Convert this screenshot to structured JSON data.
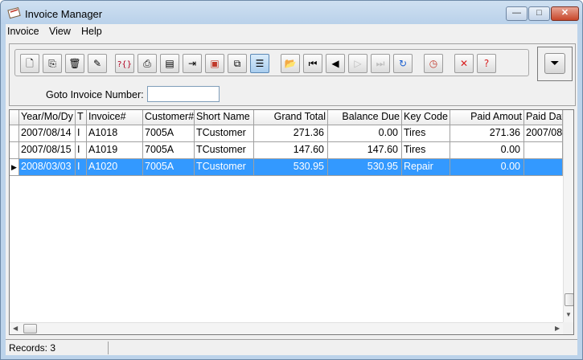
{
  "window": {
    "title": "Invoice Manager",
    "controls": {
      "minimize": "—",
      "maximize": "□",
      "close": "✕"
    }
  },
  "menu": [
    "Invoice",
    "View",
    "Help"
  ],
  "toolbar": {
    "buttons": [
      {
        "name": "new-icon",
        "glyph": "🗋"
      },
      {
        "name": "copy-icon",
        "glyph": "⎘"
      },
      {
        "name": "delete-icon",
        "glyph": "🗑"
      },
      {
        "name": "edit-icon",
        "glyph": "✎"
      },
      {
        "name": "query-icon",
        "glyph": "?{}"
      },
      {
        "name": "print-icon",
        "glyph": "⎙"
      },
      {
        "name": "print-labels-icon",
        "glyph": "▤"
      },
      {
        "name": "export-icon",
        "glyph": "⇥"
      },
      {
        "name": "pdf-icon",
        "glyph": "▣"
      },
      {
        "name": "preview-icon",
        "glyph": "⧉"
      },
      {
        "name": "list-view-icon",
        "glyph": "☰",
        "active": true
      },
      {
        "name": "open-folder-icon",
        "glyph": "📂"
      },
      {
        "name": "first-record-icon",
        "glyph": "⏮"
      },
      {
        "name": "previous-record-icon",
        "glyph": "◀"
      },
      {
        "name": "next-record-icon",
        "glyph": "▷",
        "disabled": true
      },
      {
        "name": "last-record-icon",
        "glyph": "⏭",
        "disabled": true
      },
      {
        "name": "refresh-icon",
        "glyph": "↻"
      },
      {
        "name": "clock-icon",
        "glyph": "◷"
      },
      {
        "name": "cancel-icon",
        "glyph": "✕"
      },
      {
        "name": "help-icon",
        "glyph": "?"
      }
    ],
    "filter_glyph": "⏷"
  },
  "goto": {
    "label": "Goto Invoice Number:",
    "value": ""
  },
  "grid": {
    "columns": [
      "Year/Mo/Dy",
      "T",
      "Invoice#",
      "Customer#",
      "Short Name",
      "Grand Total",
      "Balance Due",
      "Key Code",
      "Paid Amout",
      "Paid Dat"
    ],
    "rows": [
      {
        "date": "2007/08/14",
        "t": "I",
        "invoice": "A1018",
        "customer": "7005A",
        "short": "TCustomer",
        "grand": "271.36",
        "balance": "0.00",
        "key": "Tires",
        "paid": "271.36",
        "paid_date": "2007/08",
        "selected": false
      },
      {
        "date": "2007/08/15",
        "t": "I",
        "invoice": "A1019",
        "customer": "7005A",
        "short": "TCustomer",
        "grand": "147.60",
        "balance": "147.60",
        "key": "Tires",
        "paid": "0.00",
        "paid_date": "",
        "selected": false
      },
      {
        "date": "2008/03/03",
        "t": "I",
        "invoice": "A1020",
        "customer": "7005A",
        "short": "TCustomer",
        "grand": "530.95",
        "balance": "530.95",
        "key": "Repair",
        "paid": "0.00",
        "paid_date": "",
        "selected": true
      }
    ]
  },
  "status": {
    "records": "Records: 3"
  },
  "colors": {
    "selection": "#3399ff",
    "titlebar": "#bcd3ea",
    "close": "#c8462a"
  }
}
